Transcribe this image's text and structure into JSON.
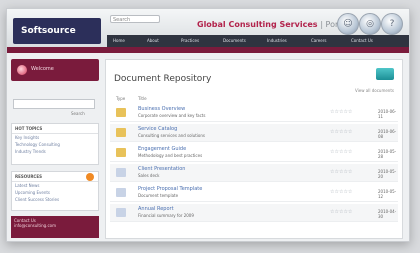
{
  "header": {
    "logo_text": "Softsource",
    "search_placeholder": "Search",
    "portal_title": "Global Consulting Services",
    "portal_suffix": "| Portal",
    "nav_items": [
      "Home",
      "About",
      "Practices",
      "Documents",
      "Industries",
      "Careers",
      "Contact Us"
    ]
  },
  "sidebar": {
    "top_label": "Welcome",
    "search_button": "Search",
    "topics": {
      "heading": "HOT TOPICS",
      "lines": [
        "Key Insights",
        "Technology Consulting",
        "Industry Trends"
      ]
    },
    "resources": {
      "heading": "RESOURCES",
      "lines": [
        "Latest News",
        "Upcoming Events",
        "Client Success Stories"
      ]
    },
    "bottom_lines": [
      "Contact Us",
      "info@consulting.com"
    ]
  },
  "main": {
    "title": "Document Repository",
    "filter_text": "View all documents",
    "col_type": "Type",
    "col_title": "Title",
    "documents": [
      {
        "title": "Business Overview",
        "sub": "Corporate overview and key facts",
        "date": "2010-06-11",
        "color": "#e8c25a"
      },
      {
        "title": "Service Catalog",
        "sub": "Consulting services and solutions",
        "date": "2010-06-08",
        "color": "#e8c25a"
      },
      {
        "title": "Engagement Guide",
        "sub": "Methodology and best practices",
        "date": "2010-05-28",
        "color": "#e8c25a"
      },
      {
        "title": "Client Presentation",
        "sub": "Sales deck",
        "date": "2010-05-20",
        "color": "#c8d3e6"
      },
      {
        "title": "Project Proposal Template",
        "sub": "Document template",
        "date": "2010-05-12",
        "color": "#c8d3e6"
      },
      {
        "title": "Annual Report",
        "sub": "Financial summary for 2009",
        "date": "2010-04-30",
        "color": "#c8d3e6"
      }
    ],
    "stars": "☆☆☆☆☆"
  }
}
